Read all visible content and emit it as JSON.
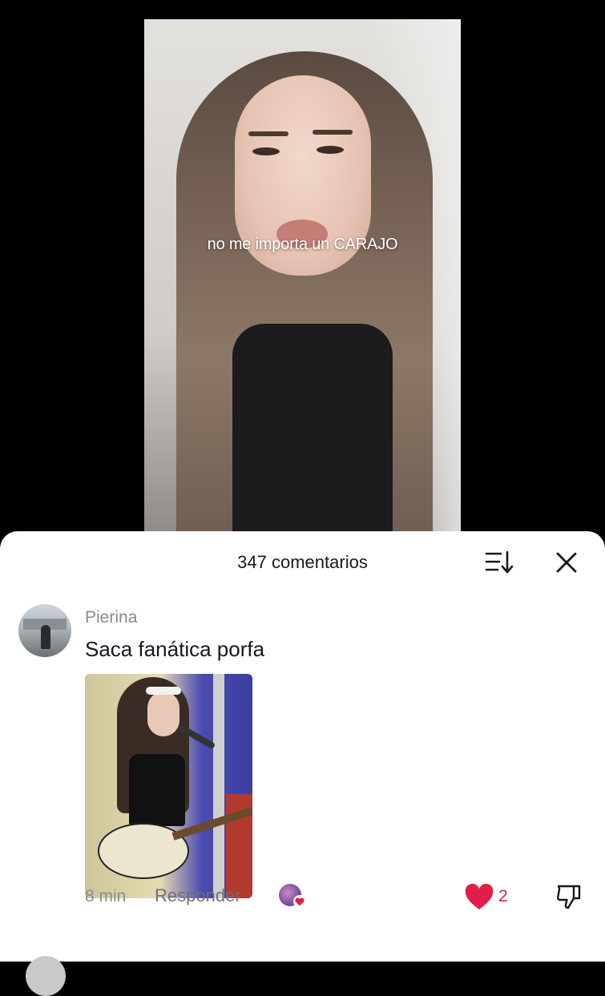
{
  "video": {
    "caption": "no me importa un CARAJO"
  },
  "comments_panel": {
    "count_label": "347 comentarios",
    "sort_icon": "sort-descending-icon",
    "close_icon": "close-icon"
  },
  "comment": {
    "username": "Pierina",
    "text": "Saca fanática porfa",
    "time": "8 min",
    "reply_label": "Responder",
    "like_count": "2",
    "like_color": "#e11d48"
  }
}
